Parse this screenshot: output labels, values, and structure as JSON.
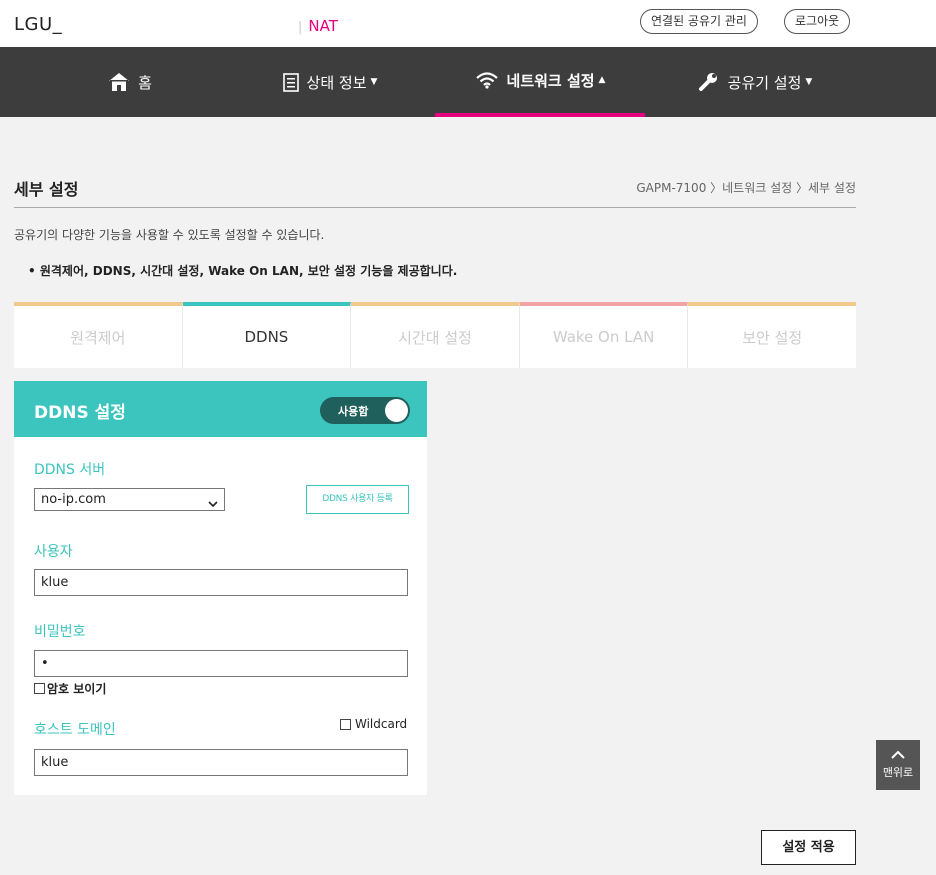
{
  "header": {
    "brand": "LGU_",
    "mode_separator": "|",
    "mode": "NAT",
    "manage_button": "연결된 공유기 관리",
    "logout_button": "로그아웃"
  },
  "nav": {
    "home": "홈",
    "status": "상태 정보",
    "network": "네트워크 설정",
    "router": "공유기 설정",
    "caret_down": "▼",
    "caret_up": "▲"
  },
  "page": {
    "title": "세부 설정",
    "breadcrumb": "GAPM-7100 〉네트워크 설정 〉세부 설정",
    "description": "공유기의 다양한 기능을 사용할 수 있도록 설정할 수 있습니다.",
    "bullet": "• 원격제어, DDNS, 시간대 설정, Wake On LAN, 보안 설정 기능을 제공합니다."
  },
  "tabs": {
    "remote": "원격제어",
    "ddns": "DDNS",
    "timezone": "시간대 설정",
    "wol": "Wake On LAN",
    "security": "보안 설정",
    "active": "DDNS"
  },
  "ddns": {
    "title": "DDNS 설정",
    "toggle_label": "사용함",
    "server_label": "DDNS 서버",
    "server_value": "no-ip.com",
    "register_button": "DDNS 사용자 등록",
    "user_label": "사용자",
    "user_value": "klue",
    "password_label": "비밀번호",
    "password_value": "•",
    "show_password": "암호 보이기",
    "host_label": "호스트 도메인",
    "wildcard_label": "Wildcard",
    "host_value": "klue"
  },
  "actions": {
    "apply": "설정 적용",
    "to_top": "맨위로"
  },
  "colors": {
    "accent_pink": "#e6007e",
    "teal": "#3cc4bf",
    "nav_bg": "#3d3d3d"
  },
  "icons": {
    "home": "home-icon",
    "status": "document-icon",
    "network": "wifi-icon",
    "router": "wrench-icon"
  }
}
